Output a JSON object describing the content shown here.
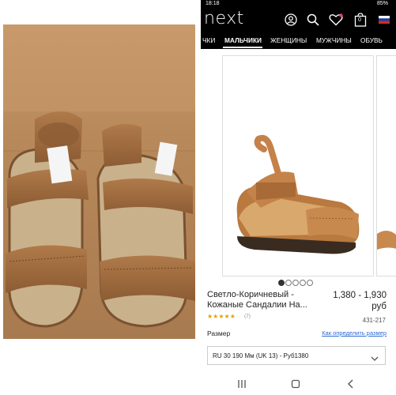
{
  "status_bar": {
    "time": "18:18",
    "battery": "85%"
  },
  "header": {
    "logo": "next",
    "bag_count": "0"
  },
  "nav": {
    "items": [
      {
        "label": "ЧКИ"
      },
      {
        "label": "МАЛЬЧИКИ",
        "active": true
      },
      {
        "label": "ЖЕНЩИНЫ"
      },
      {
        "label": "МУЖЧИНЫ"
      },
      {
        "label": "ОБУВЬ"
      }
    ]
  },
  "product": {
    "title_line1": "Светло-Коричневый -",
    "title_line2": "Кожаные Сандалии На...",
    "price_line1": "1,380 - 1,930",
    "price_line2": "руб",
    "rating": 5,
    "rating_count": "(7)",
    "sku": "431-217",
    "size_label": "Размер",
    "size_link": "Как определить размер",
    "size_selected": "RU 30 190 Мм (UK 13) - Руб1380"
  },
  "gallery": {
    "dots": 5,
    "active_index": 0
  },
  "colors": {
    "header_bg": "#000000",
    "accent_link": "#2a6bd1",
    "star": "#e6a000",
    "wishlist": "#e0398a"
  },
  "icons": [
    "account-icon",
    "search-icon",
    "heart-icon",
    "bag-icon",
    "flag-icon",
    "chevron-down-icon",
    "recents-icon",
    "home-icon",
    "back-icon"
  ]
}
